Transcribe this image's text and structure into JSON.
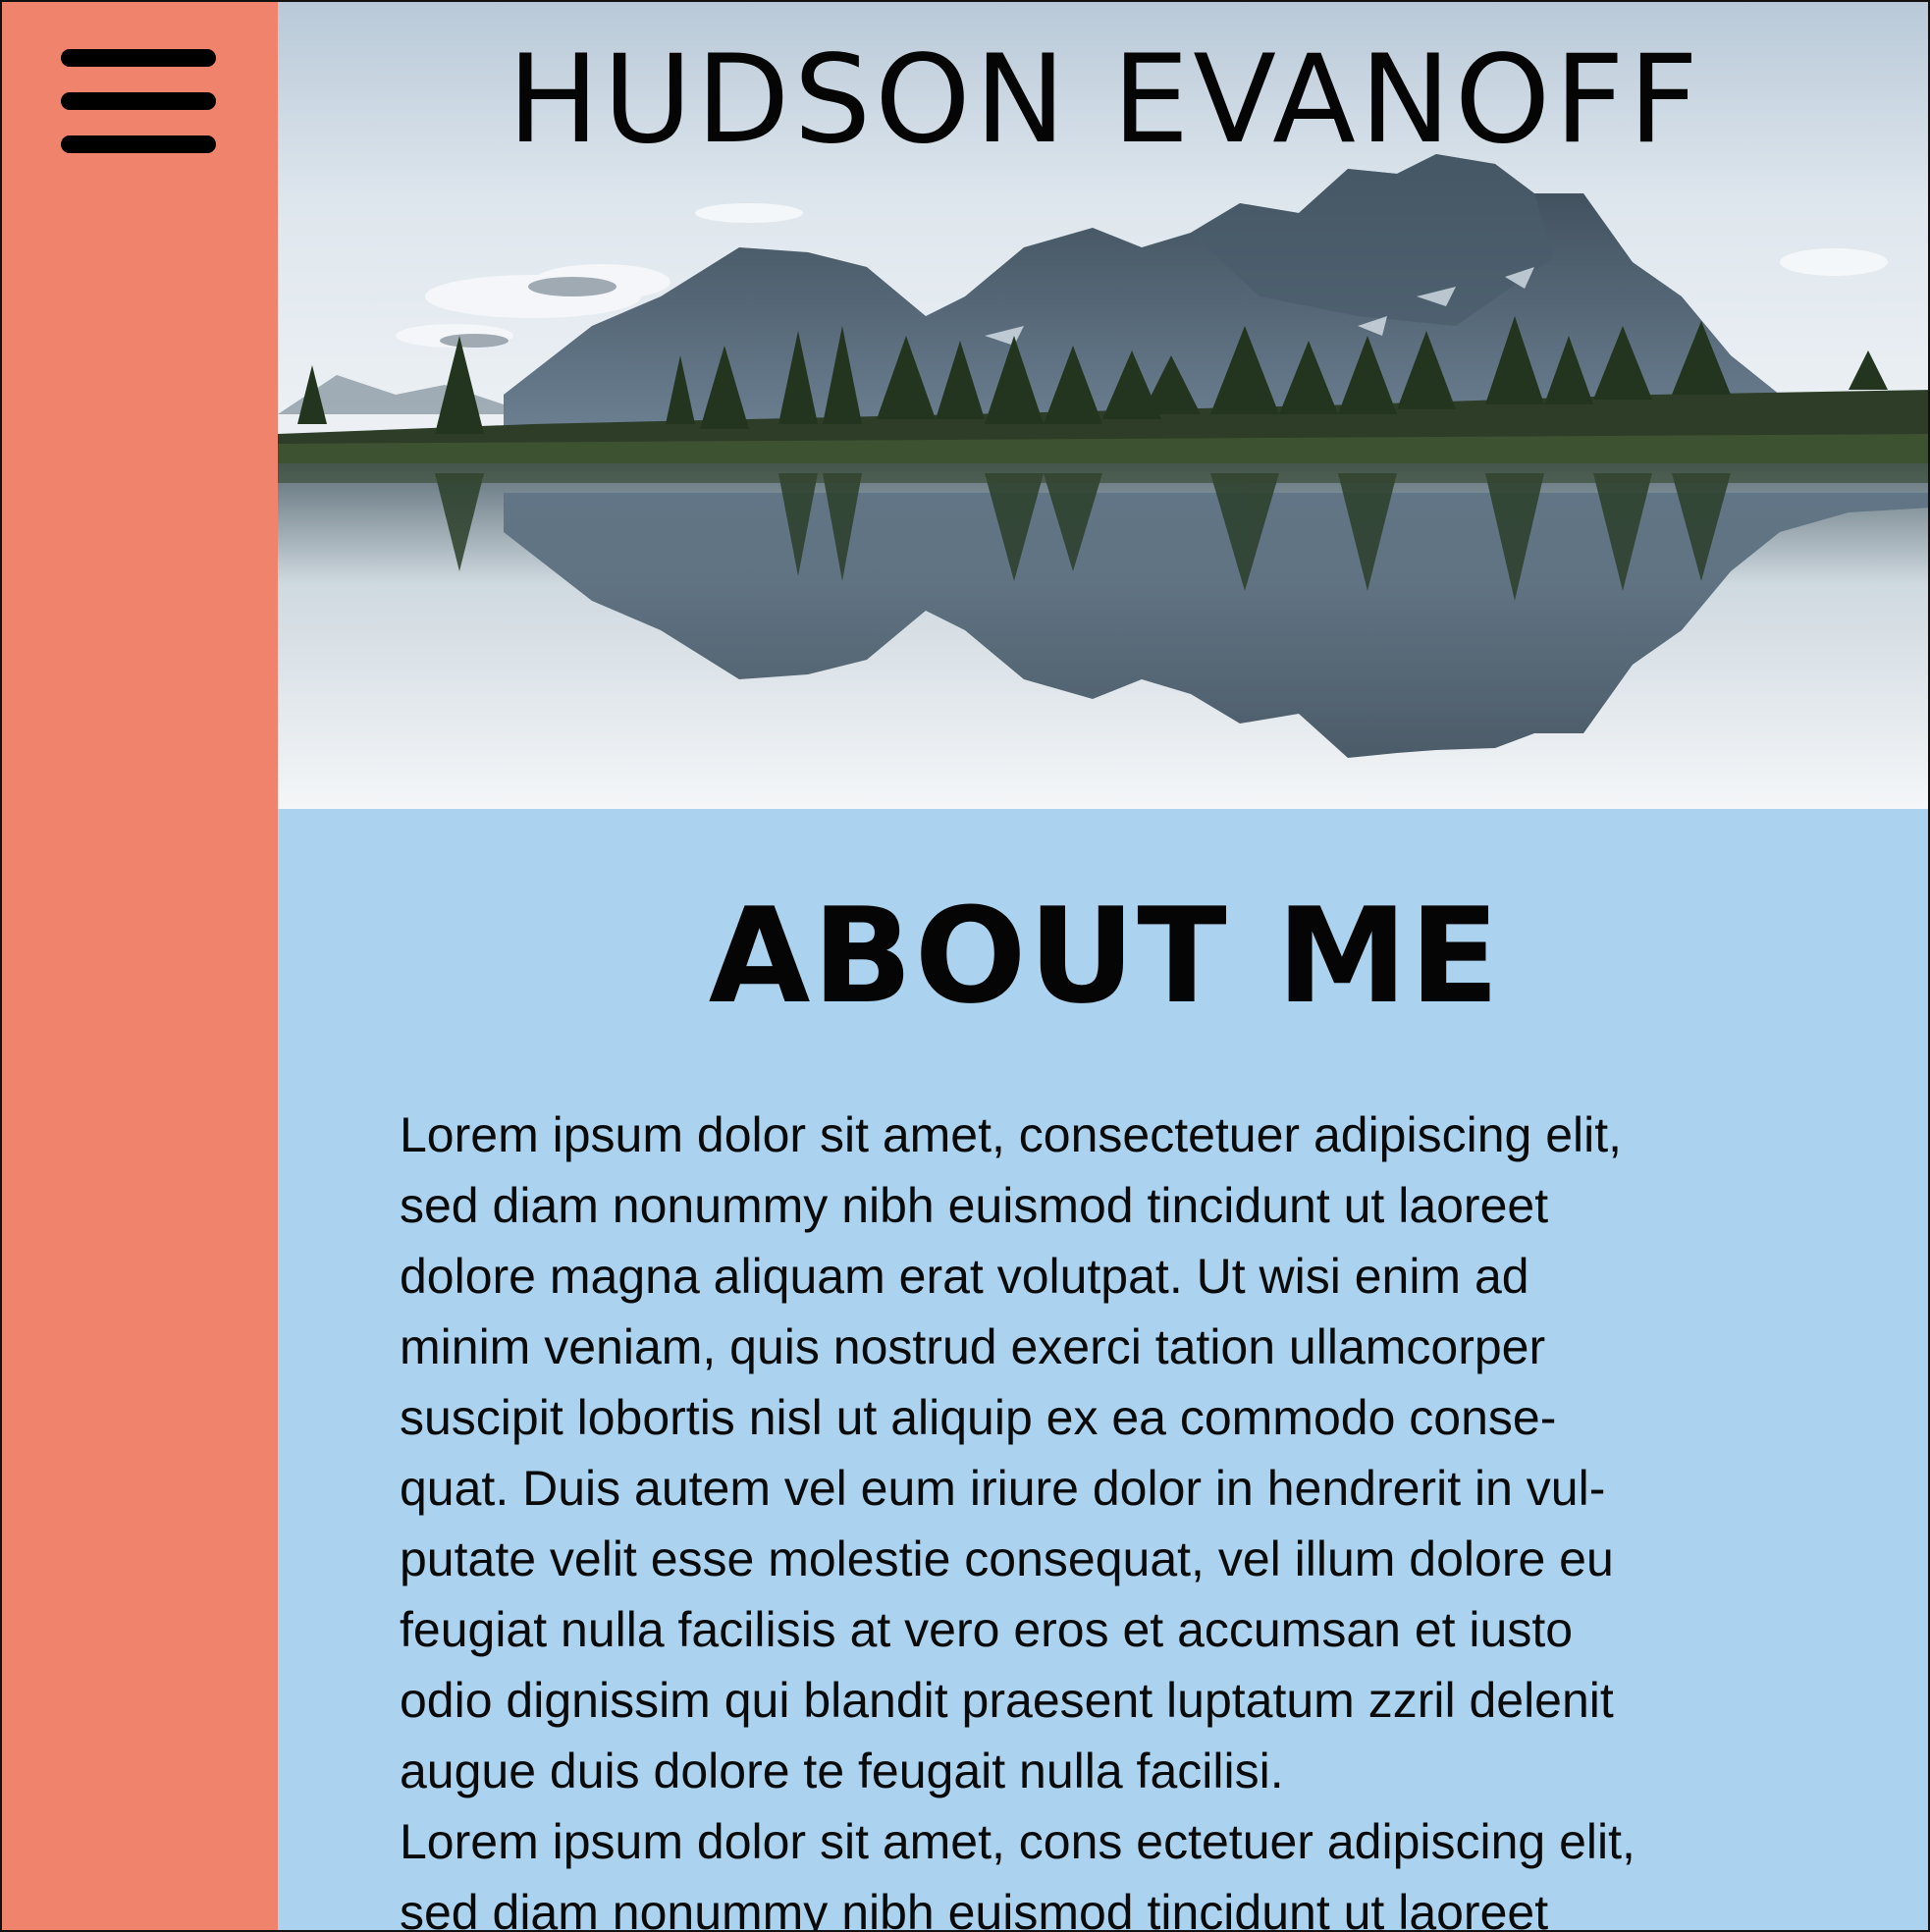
{
  "sidebar": {
    "menu_icon": "hamburger-menu-icon",
    "background": "#ef836c"
  },
  "header": {
    "title": "HUDSON EVANOFF"
  },
  "about": {
    "heading": "ABOUT ME",
    "background": "#abd2ee",
    "lines": [
      "Lorem ipsum dolor sit amet, consectetuer adipiscing elit,",
      "sed diam nonummy nibh euismod tincidunt ut laoreet",
      "dolore magna aliquam erat volutpat. Ut wisi enim ad",
      "minim veniam, quis nostrud exerci tation ullamcorper",
      "suscipit lobortis nisl ut aliquip ex ea commodo conse-",
      "quat. Duis autem vel eum iriure dolor in hendrerit in vul-",
      "putate velit esse molestie consequat, vel illum dolore eu",
      "feugiat nulla facilisis at vero eros et accumsan et iusto",
      "odio dignissim qui blandit praesent luptatum zzril delenit",
      "augue duis dolore te feugait nulla facilisi.",
      "Lorem ipsum dolor sit amet, cons ectetuer adipiscing elit,",
      "sed diam nonummy nibh euismod tincidunt ut laoreet"
    ]
  }
}
